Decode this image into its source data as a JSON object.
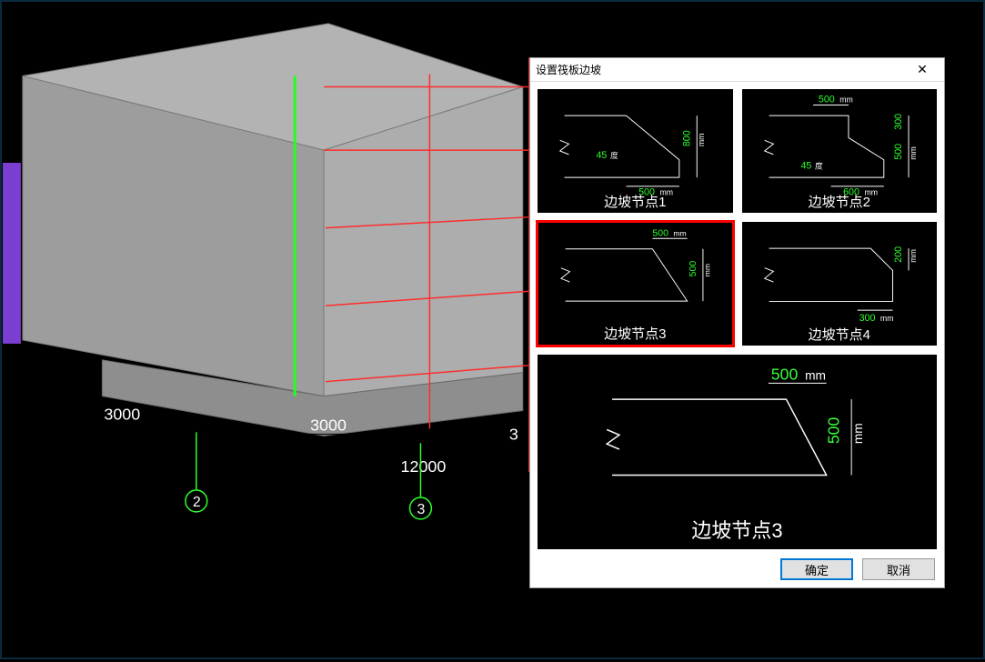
{
  "viewport": {
    "dims": {
      "left_span": "3000",
      "right_span": "3000",
      "right_cut": "3",
      "total": "12000"
    },
    "grid_bubbles": [
      "2",
      "3"
    ]
  },
  "dialog": {
    "title": "设置筏板边坡",
    "thumbs": [
      {
        "label": "边坡节点1",
        "angle": "45",
        "angle_unit": "度",
        "h": "800",
        "w": "500",
        "unit": "mm"
      },
      {
        "label": "边坡节点2",
        "angle": "45",
        "angle_unit": "度",
        "top_w": "500",
        "h1": "300",
        "h2": "500",
        "w": "600",
        "unit": "mm"
      },
      {
        "label": "边坡节点3",
        "w": "500",
        "h": "500",
        "unit": "mm"
      },
      {
        "label": "边坡节点4",
        "w": "300",
        "h": "200",
        "unit": "mm"
      }
    ],
    "selected_index": 2,
    "preview": {
      "label": "边坡节点3",
      "w": "500",
      "h": "500",
      "unit": "mm"
    },
    "buttons": {
      "ok": "确定",
      "cancel": "取消"
    }
  }
}
